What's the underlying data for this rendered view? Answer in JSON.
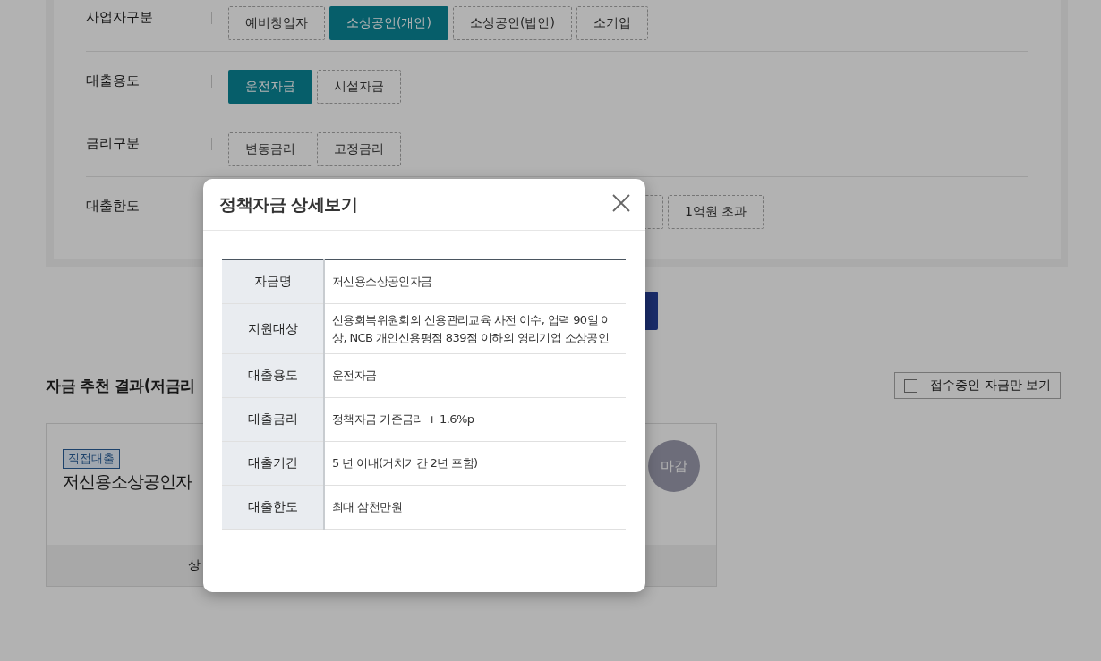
{
  "filters": [
    {
      "label": "사업자구분",
      "options": [
        {
          "label": "예비창업자",
          "selected": false
        },
        {
          "label": "소상공인(개인)",
          "selected": true
        },
        {
          "label": "소상공인(법인)",
          "selected": false
        },
        {
          "label": "소기업",
          "selected": false
        }
      ]
    },
    {
      "label": "대출용도",
      "options": [
        {
          "label": "운전자금",
          "selected": true
        },
        {
          "label": "시설자금",
          "selected": false
        }
      ]
    },
    {
      "label": "금리구분",
      "options": [
        {
          "label": "변동금리",
          "selected": false
        },
        {
          "label": "고정금리",
          "selected": false
        }
      ]
    },
    {
      "label": "대출한도",
      "options": [
        {
          "label": "1억원 초과",
          "selected": false
        }
      ]
    }
  ],
  "results": {
    "heading": "자금 추천 결과(저금리",
    "open_only": {
      "label": "접수중인 자금만 보기",
      "checked": false
    },
    "cards": [
      {
        "badge": "직접대출",
        "title": "저신용소상공인자",
        "status": "마감",
        "footer": "상"
      }
    ]
  },
  "modal": {
    "title": "정책자금 상세보기",
    "rows": [
      {
        "label": "자금명",
        "value": "저신용소상공인자금"
      },
      {
        "label": "지원대상",
        "value": "신용회복위원회의 신용관리교육 사전 이수, 업력 90일 이상, NCB 개인신용평점 839점 이하의 영리기업 소상공인"
      },
      {
        "label": "대출용도",
        "value": "운전자금"
      },
      {
        "label": "대출금리",
        "value": "정책자금 기준금리 + 1.6%p"
      },
      {
        "label": "대출기간",
        "value": "5 년 이내(거치기간 2년 포함)"
      },
      {
        "label": "대출한도",
        "value": "최대 삼천만원"
      }
    ]
  }
}
